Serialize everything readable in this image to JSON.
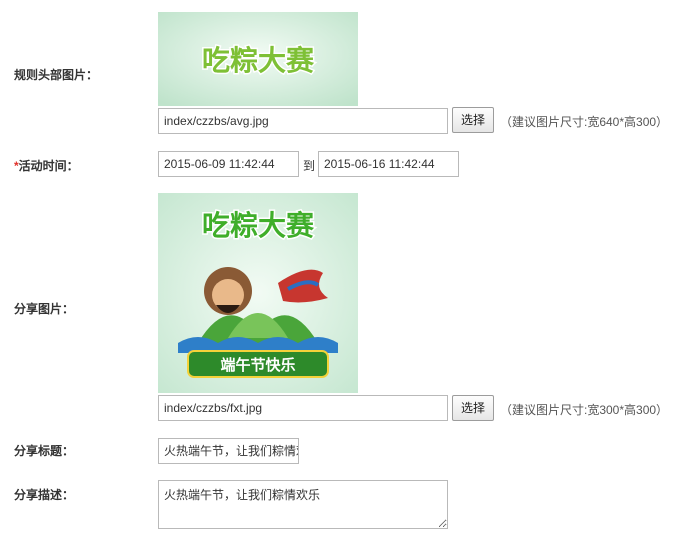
{
  "form": {
    "header_image": {
      "label": "规则头部图片：",
      "image_title": "吃粽大赛",
      "path_value": "index/czzbs/avg.jpg",
      "choose_button": "选择",
      "hint": "（建议图片尺寸:宽640*高300）"
    },
    "activity_time": {
      "required_mark": "*",
      "label": "活动时间：",
      "start_value": "2015-06-09 11:42:44",
      "to_text": "到",
      "end_value": "2015-06-16  11:42:44"
    },
    "share_image": {
      "label": "分享图片：",
      "image_title": "吃粽大赛",
      "image_subtitle": "端午节快乐",
      "path_value": "index/czzbs/fxt.jpg",
      "choose_button": "选择",
      "hint": "（建议图片尺寸:宽300*高300）"
    },
    "share_title": {
      "label": "分享标题：",
      "value": "火热端午节，让我们粽情欢乐"
    },
    "share_desc": {
      "label": "分享描述：",
      "value": "火热端午节，让我们粽情欢乐"
    }
  },
  "colors": {
    "required": "#e0302a",
    "title_green": "#3fae2a",
    "title_yellow": "#f4e24a",
    "image_bg": "#d7eedf"
  }
}
